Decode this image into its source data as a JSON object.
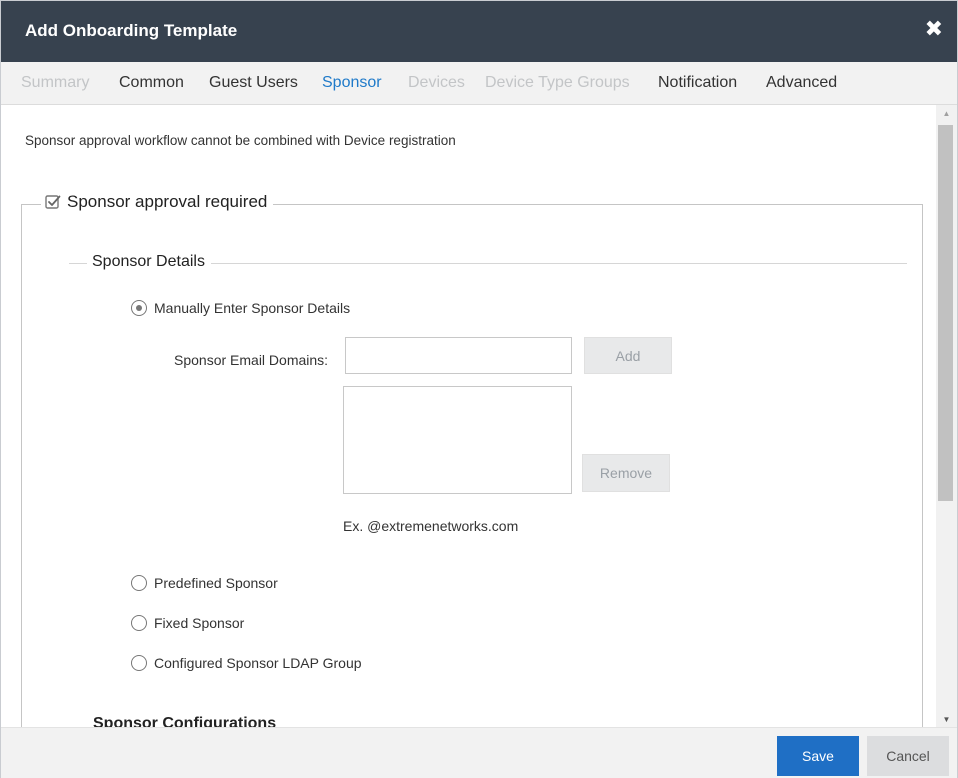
{
  "dialog": {
    "title": "Add Onboarding Template",
    "close_icon": "close-icon"
  },
  "tabs": [
    {
      "label": "Summary",
      "state": "disabled"
    },
    {
      "label": "Common",
      "state": "normal"
    },
    {
      "label": "Guest Users",
      "state": "normal"
    },
    {
      "label": "Sponsor",
      "state": "active"
    },
    {
      "label": "Devices",
      "state": "disabled"
    },
    {
      "label": "Device Type Groups",
      "state": "disabled"
    },
    {
      "label": "Notification",
      "state": "normal"
    },
    {
      "label": "Advanced",
      "state": "normal"
    }
  ],
  "sponsor": {
    "note": "Sponsor approval workflow cannot be combined with Device registration",
    "approval_required": {
      "label": "Sponsor approval required",
      "checked": true
    },
    "details": {
      "title": "Sponsor Details",
      "options": [
        {
          "label": "Manually Enter Sponsor Details",
          "checked": true
        },
        {
          "label": "Predefined Sponsor",
          "checked": false
        },
        {
          "label": "Fixed Sponsor",
          "checked": false
        },
        {
          "label": "Configured Sponsor LDAP Group",
          "checked": false
        }
      ],
      "email_domains_label": "Sponsor Email Domains:",
      "email_domains_value": "",
      "add_label": "Add",
      "remove_label": "Remove",
      "hint": "Ex. @extremenetworks.com",
      "domains_list": []
    },
    "next_section_partial": "Sponsor Configurations"
  },
  "footer": {
    "save_label": "Save",
    "cancel_label": "Cancel"
  },
  "colors": {
    "titlebar": "#37424f",
    "active_tab": "#1f7ac9",
    "save_button": "#1f6fc5"
  }
}
